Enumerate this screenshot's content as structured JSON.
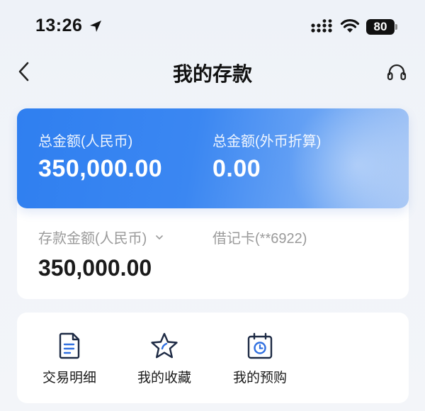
{
  "status_bar": {
    "time": "13:26",
    "battery": "80"
  },
  "nav": {
    "title": "我的存款"
  },
  "summary": {
    "total_cny_label": "总金额(人民币)",
    "total_cny_value": "350,000.00",
    "total_fx_label": "总金额(外币折算)",
    "total_fx_value": "0.00"
  },
  "deposit": {
    "amount_label": "存款金额(人民币)",
    "amount_value": "350,000.00",
    "card_label": "借记卡(**6922)"
  },
  "functions": [
    {
      "label": "交易明细",
      "icon": "document-icon"
    },
    {
      "label": "我的收藏",
      "icon": "star-icon"
    },
    {
      "label": "我的预购",
      "icon": "calendar-clock-icon"
    }
  ],
  "colors": {
    "card_blue": "#3b87f2",
    "accent": "#2f6fe0"
  }
}
